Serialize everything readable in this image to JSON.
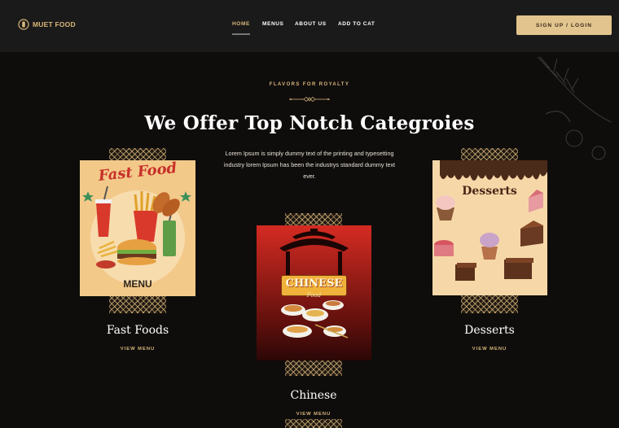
{
  "header": {
    "logo_text": "MUET FOOD",
    "nav": [
      {
        "label": "HOME",
        "active": true
      },
      {
        "label": "MENUS",
        "active": false
      },
      {
        "label": "ABOUT US",
        "active": false
      },
      {
        "label": "ADD TO CAT",
        "active": false
      }
    ],
    "signup_label": "SIGN UP / LOGIN"
  },
  "hero": {
    "eyebrow": "FLAVORS FOR ROYALTY",
    "title": "We Offer Top Notch Categroies",
    "intro": "Lorem Ipsum is simply dummy text of the printing and typesetting industry lorem Ipsum has been the industrys standard dummy text ever."
  },
  "categories": [
    {
      "title": "Fast Foods",
      "link": "VIEW MENU",
      "poster": {
        "heading": "Fast Food",
        "footer": "MENU"
      }
    },
    {
      "title": "Chinese",
      "link": "VIEW MENU",
      "poster": {
        "heading": "CHINESE",
        "sub": "Food"
      }
    },
    {
      "title": "Desserts",
      "link": "VIEW MENU",
      "poster": {
        "heading": "Desserts"
      }
    }
  ],
  "colors": {
    "background": "#0f0d0c",
    "header": "#1b1a1a",
    "accent_gold": "#d8b67a",
    "button": "#e2c48e"
  },
  "icons": [
    "logo-mark-icon",
    "ornament-divider-icon",
    "decorative-leaf-icon"
  ]
}
